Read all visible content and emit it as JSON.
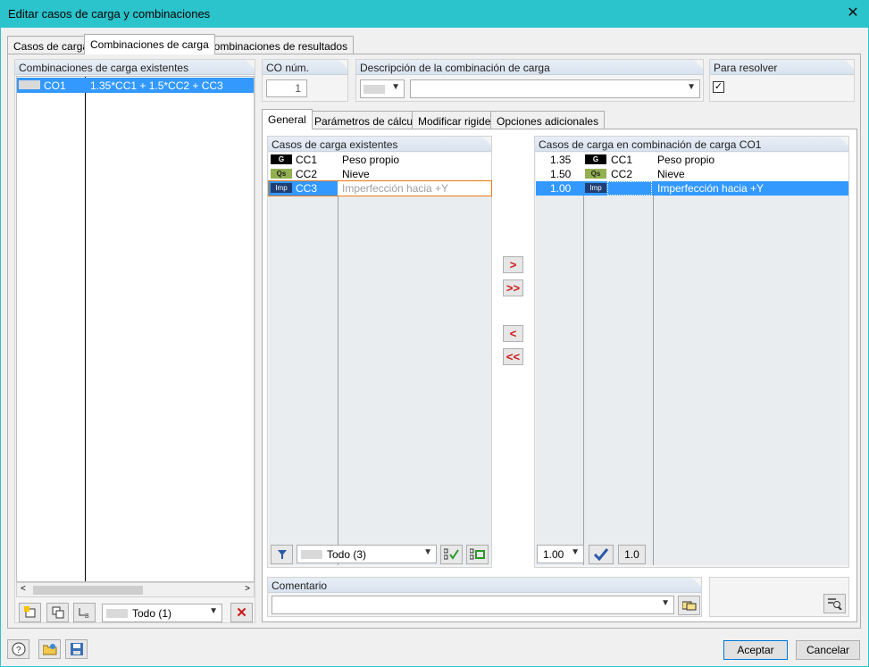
{
  "window": {
    "title": "Editar casos de carga y combinaciones",
    "close_glyph": "✕"
  },
  "tabs": [
    {
      "label": "Casos de carga"
    },
    {
      "label": "Combinaciones de carga"
    },
    {
      "label": "Combinaciones de resultados"
    }
  ],
  "left_panel": {
    "header": "Combinaciones de carga existentes",
    "rows": [
      {
        "id": "CO1",
        "formula": "1.35*CC1 + 1.5*CC2 + CC3"
      }
    ],
    "filter_value": "Todo (1)"
  },
  "co_num": {
    "label": "CO núm.",
    "value": "1"
  },
  "description": {
    "label": "Descripción de la combinación de carga",
    "value": ""
  },
  "to_solve": {
    "label": "Para resolver",
    "checked": true
  },
  "inner_tabs": [
    {
      "label": "General"
    },
    {
      "label": "Parámetros de cálculo"
    },
    {
      "label": "Modificar rigidez"
    },
    {
      "label": "Opciones adicionales"
    }
  ],
  "existing_cases": {
    "header": "Casos de carga existentes",
    "rows": [
      {
        "badge": "G",
        "id": "CC1",
        "name": "Peso propio"
      },
      {
        "badge": "Qs",
        "id": "CC2",
        "name": "Nieve"
      },
      {
        "badge": "Imp",
        "id": "CC3",
        "name": "Imperfección hacia +Y"
      }
    ],
    "filter_value": "Todo (3)"
  },
  "combo_cases": {
    "header": "Casos de carga en combinación de carga CO1",
    "rows": [
      {
        "factor": "1.35",
        "badge": "G",
        "id": "CC1",
        "name": "Peso propio"
      },
      {
        "factor": "1.50",
        "badge": "Qs",
        "id": "CC2",
        "name": "Nieve"
      },
      {
        "factor": "1.00",
        "badge": "Imp",
        "id": "CC3",
        "name": "Imperfección hacia +Y"
      }
    ],
    "factor_value": "1.00",
    "set_one_label": "1.0"
  },
  "transfer_buttons": {
    "add": ">",
    "add_all": ">>",
    "remove": "<",
    "remove_all": "<<"
  },
  "comment": {
    "label": "Comentario",
    "value": ""
  },
  "footer": {
    "ok_label": "Aceptar",
    "cancel_label": "Cancelar"
  },
  "colors": {
    "accent": "#2bc3cc",
    "selection": "#3399ff",
    "arrow_red": "#d01818"
  }
}
